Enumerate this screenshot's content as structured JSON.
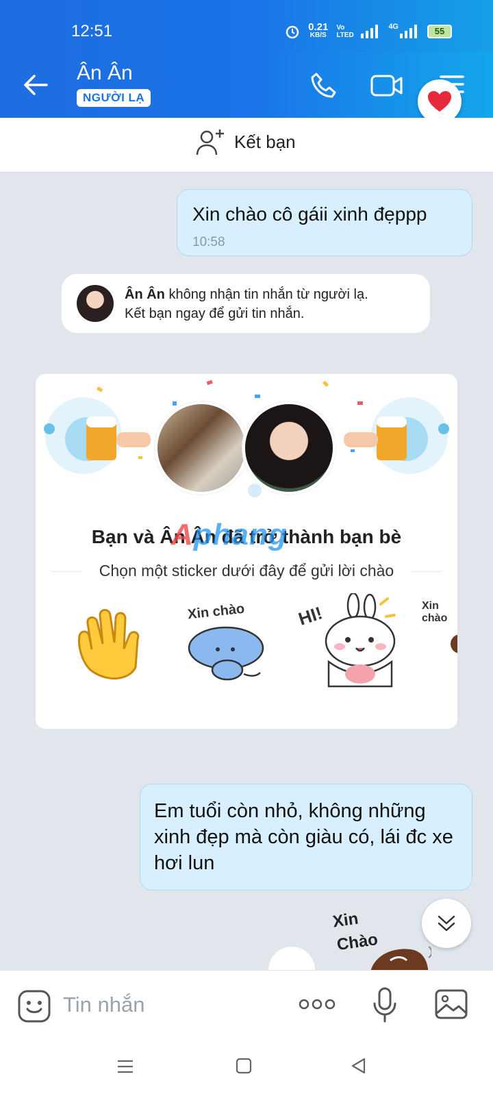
{
  "status_bar": {
    "time": "12:51",
    "net_speed": "0.21",
    "net_unit": "KB/S",
    "volte": "Vo LTED",
    "network": "4G",
    "battery": "55"
  },
  "header": {
    "contact_name": "Ân Ân",
    "badge": "NGƯỜI LẠ"
  },
  "add_friend": {
    "label": "Kết bạn"
  },
  "messages": [
    {
      "text": "Xin chào cô gáii xinh đẹppp",
      "time": "10:58"
    },
    {
      "text": "Em tuổi còn nhỏ, không những xinh đẹp mà còn giàu có, lái đc xe hơi lun"
    }
  ],
  "notice": {
    "name": "Ân Ân",
    "line1": " không nhận tin nhắn từ người lạ.",
    "line2": "Kết bạn ngay để gửi tin nhắn."
  },
  "friend_card": {
    "title": "Bạn và Ân Ân đã trở thành bạn bè",
    "subtitle": "Chọn một sticker dưới đây để gửi lời chào",
    "stickers": [
      "Xin chào",
      "HI!",
      "Xin chào"
    ]
  },
  "watermark": {
    "a": "A",
    "rest": "phang"
  },
  "bottom_sticker": {
    "text1": "Xin",
    "text2": "Chào"
  },
  "input": {
    "placeholder": "Tin nhắn"
  },
  "colors": {
    "header_blue": "#1a73e8",
    "bubble_out": "#d7efff",
    "chat_bg": "#e1e6ec"
  }
}
